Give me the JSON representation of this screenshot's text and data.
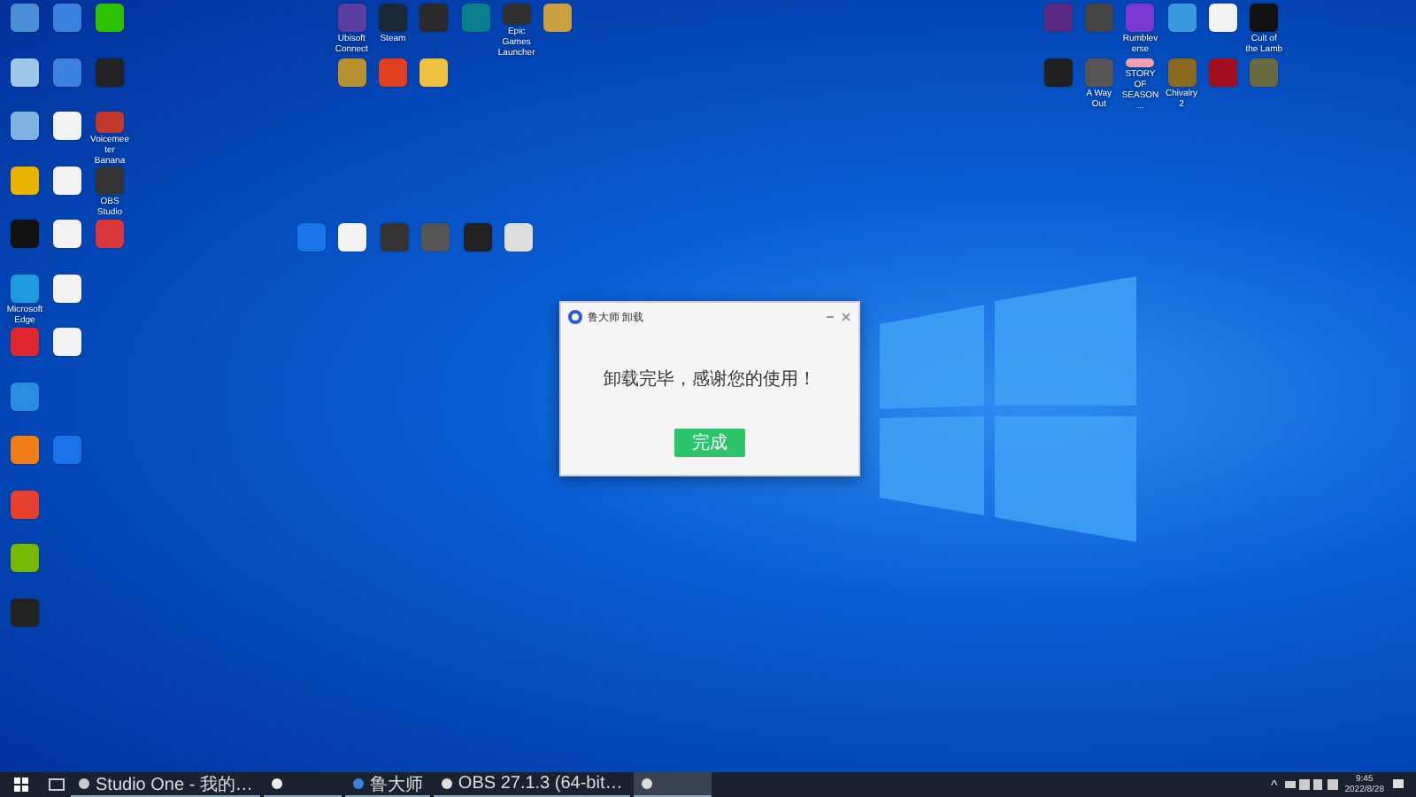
{
  "desktop_icons": {
    "left": [
      [
        {
          "color": "#4a90d9"
        },
        {
          "color": "#3b82e0"
        },
        {
          "color": "#2dc100"
        }
      ],
      [
        {
          "color": "#9ec6e8"
        },
        {
          "color": "#3b82e0"
        },
        {
          "color": "#222222"
        }
      ],
      [
        {
          "color": "#7fb3e0"
        },
        {
          "color": "#f2f2f2"
        },
        {
          "color": "#c0392b",
          "label": "Voicemeeter Banana"
        }
      ],
      [
        {
          "color": "#e8b400"
        },
        {
          "color": "#f2f2f2"
        },
        {
          "color": "#333333",
          "label": "OBS Studio"
        }
      ],
      [
        {
          "color": "#111111"
        },
        {
          "color": "#f2f2f2"
        },
        {
          "color": "#d9363e"
        }
      ],
      [
        {
          "color": "#1e9be0",
          "label": "Microsoft Edge"
        },
        {
          "color": "#f2f2f2"
        }
      ],
      [
        {
          "color": "#e0262e"
        },
        {
          "color": "#f2f2f2"
        }
      ],
      [
        {
          "color": "#2a8ee0"
        }
      ],
      [
        {
          "color": "#f07c1a"
        },
        {
          "color": "#1a73e8"
        }
      ],
      [
        {
          "color": "#e8402e"
        }
      ],
      [
        {
          "color": "#76b900"
        }
      ],
      [
        {
          "color": "#222222"
        }
      ]
    ],
    "top": [
      [
        {
          "color": "#5b3fa0",
          "label": "Ubisoft Connect"
        },
        {
          "color": "#1b2838",
          "label": "Steam"
        },
        {
          "color": "#2a2a2a"
        },
        {
          "color": "#0a7e8c"
        },
        {
          "color": "#303030",
          "label": "Epic Games Launcher"
        },
        {
          "color": "#c8a040"
        }
      ],
      [
        {
          "color": "#b89030"
        },
        {
          "color": "#e04020"
        },
        {
          "color": "#f0c040"
        }
      ]
    ],
    "middle": [
      [
        {
          "color": "#1a73e8"
        },
        {
          "color": "#f2f2f2"
        },
        {
          "color": "#333333"
        },
        {
          "color": "#555555"
        },
        {
          "color": "#222222"
        },
        {
          "color": "#dddddd"
        }
      ]
    ],
    "right": [
      [
        {
          "color": "#5a2a80"
        },
        {
          "color": "#444444"
        },
        {
          "color": "#7a3ad0",
          "label": "Rumbleverse"
        },
        {
          "color": "#3a9ae0"
        },
        {
          "color": "#f2f2f2"
        },
        {
          "color": "#111111",
          "label": "Cult of the Lamb"
        }
      ],
      [
        {
          "color": "#202020"
        },
        {
          "color": "#555555",
          "label": "A Way Out"
        },
        {
          "color": "#f0a0b0",
          "label": "STORY OF SEASON..."
        },
        {
          "color": "#8a6a20",
          "label": "Chivalry 2"
        },
        {
          "color": "#a01020"
        },
        {
          "color": "#6a6a40"
        }
      ]
    ]
  },
  "dialog": {
    "title": "鲁大师 卸载",
    "message": "卸载完毕，感谢您的使用！",
    "button": "完成"
  },
  "taskbar": {
    "items": [
      {
        "label": "Studio One - 我的…",
        "selected": false
      },
      {
        "selected": false
      },
      {
        "label": "鲁大师",
        "selected": false
      },
      {
        "label": "OBS 27.1.3 (64-bit…",
        "selected": false
      },
      {
        "selected": true
      }
    ],
    "tray": {
      "caret": "^",
      "time": "9:45",
      "date": "2022/8/28"
    }
  }
}
